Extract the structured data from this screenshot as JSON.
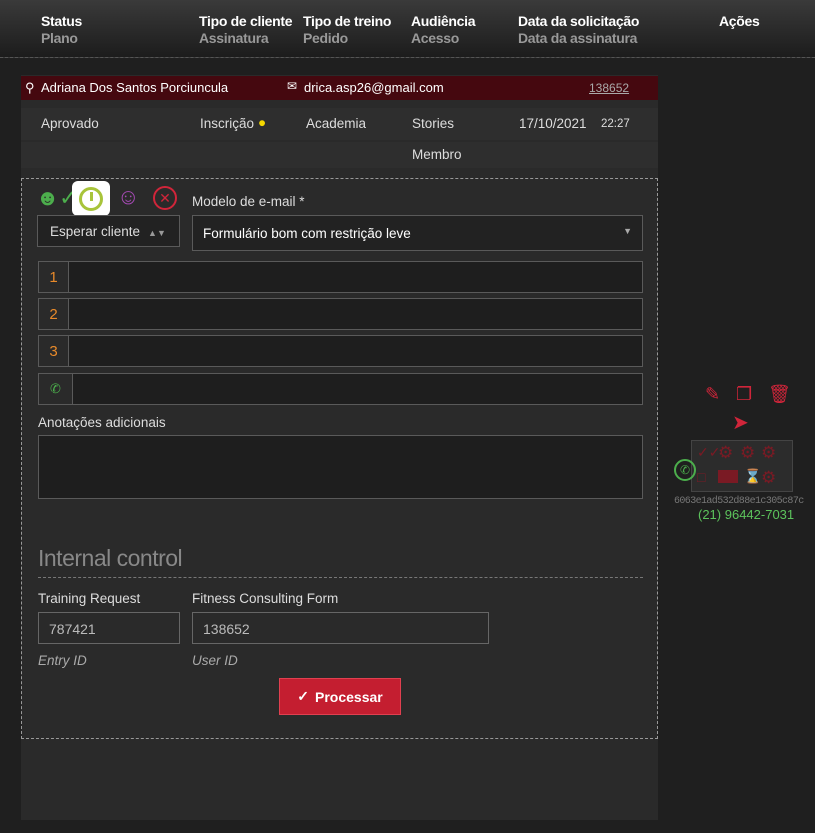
{
  "header": {
    "columns": [
      {
        "title": "Status",
        "sub": "Plano"
      },
      {
        "title": "Tipo de cliente",
        "sub": "Assinatura"
      },
      {
        "title": "Tipo de treino",
        "sub": "Pedido"
      },
      {
        "title": "Audiência",
        "sub": "Acesso"
      },
      {
        "title": "Data da solicitação",
        "sub": "Data da assinatura"
      },
      {
        "title": "Ações",
        "sub": ""
      }
    ]
  },
  "record": {
    "name": "Adriana Dos Santos Porciuncula",
    "email": "drica.asp26@gmail.com",
    "id_link": "138652",
    "status": "Aprovado",
    "client_type": "Inscrição",
    "training_type": "Academia",
    "audience": "Stories",
    "date": "17/10/2021",
    "time": "22:27",
    "access": "Membro"
  },
  "form": {
    "status_select": "Esperar cliente",
    "email_model_label": "Modelo de e-mail *",
    "email_model_value": "Formulário bom com restrição leve",
    "fields": [
      "1",
      "2",
      "3"
    ],
    "notes_label": "Anotações adicionais",
    "internal_title": "Internal control",
    "training_request_label": "Training Request",
    "training_request_value": "787421",
    "entry_id_hint": "Entry ID",
    "fitness_form_label": "Fitness Consulting Form",
    "fitness_form_value": "138652",
    "user_id_hint": "User ID",
    "process_button": "Processar"
  },
  "actions": {
    "hash": "6063e1ad532d88e1c305c87c",
    "phone": "(21) 96442-7031"
  },
  "colors": {
    "accent": "#c8202f",
    "green": "#4cae4c"
  }
}
